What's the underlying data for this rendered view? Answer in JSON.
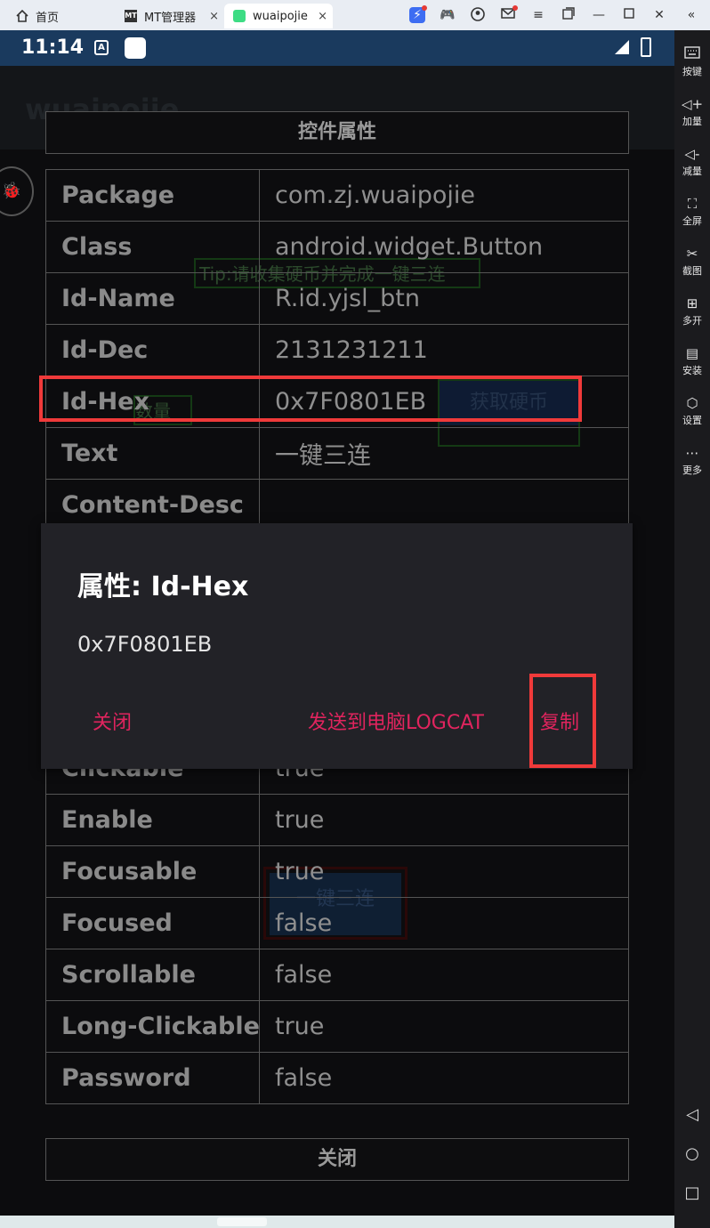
{
  "emulator": {
    "tabs": [
      {
        "label": "首页"
      },
      {
        "label": "MT管理器"
      },
      {
        "label": "wuaipojie"
      }
    ],
    "tab_close": "×",
    "sidebar": [
      {
        "label": "按键",
        "icon": "keyboard-icon"
      },
      {
        "label": "加量",
        "icon": "volume-up-icon"
      },
      {
        "label": "减量",
        "icon": "volume-down-icon"
      },
      {
        "label": "全屏",
        "icon": "fullscreen-icon"
      },
      {
        "label": "截图",
        "icon": "scissors-icon"
      },
      {
        "label": "多开",
        "icon": "multi-instance-icon"
      },
      {
        "label": "安装",
        "icon": "apk-install-icon"
      },
      {
        "label": "设置",
        "icon": "settings-icon"
      },
      {
        "label": "更多",
        "icon": "more-icon"
      }
    ]
  },
  "status_bar": {
    "time": "11:14",
    "a_badge": "A"
  },
  "app": {
    "title": "wuaipojie",
    "background": {
      "tip": "Tip:请收集硬币并完成一键三连",
      "amount": "数量",
      "get_coin": "获取硬币",
      "sanlian": "一键三连"
    }
  },
  "panel": {
    "header": "控件属性",
    "rows_top": [
      {
        "key": "Package",
        "value": "com.zj.wuaipojie"
      },
      {
        "key": "Class",
        "value": "android.widget.Button"
      },
      {
        "key": "Id-Name",
        "value": "R.id.yjsl_btn"
      },
      {
        "key": "Id-Dec",
        "value": "2131231211"
      },
      {
        "key": "Id-Hex",
        "value": "0x7F0801EB"
      },
      {
        "key": "Text",
        "value": "一键三连"
      },
      {
        "key": "Content-Desc",
        "value": ""
      }
    ],
    "rows_bottom": [
      {
        "key": "Clickable",
        "value": "true"
      },
      {
        "key": "Enable",
        "value": "true"
      },
      {
        "key": "Focusable",
        "value": "true"
      },
      {
        "key": "Focused",
        "value": "false"
      },
      {
        "key": "Scrollable",
        "value": "false"
      },
      {
        "key": "Long-Clickable",
        "value": "true"
      },
      {
        "key": "Password",
        "value": "false"
      }
    ],
    "close_button": "关闭"
  },
  "dialog": {
    "title": "属性: Id-Hex",
    "value": "0x7F0801EB",
    "close": "关闭",
    "send": "发送到电脑LOGCAT",
    "copy": "复制"
  },
  "colors": {
    "highlight": "#f03a3a",
    "dialog_button": "#e0245e",
    "status_bar": "#1a3a5e"
  }
}
